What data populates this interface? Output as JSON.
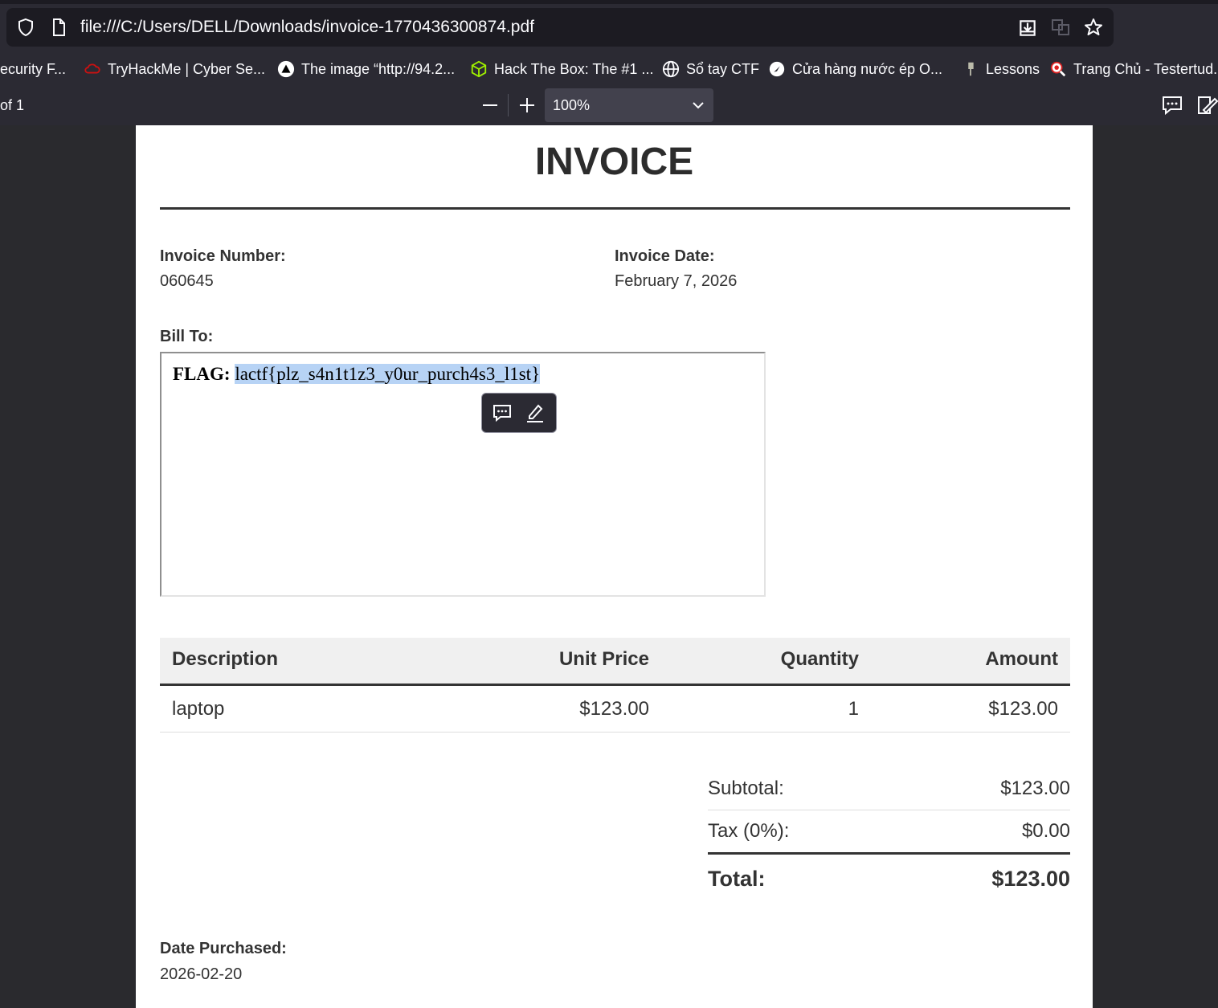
{
  "browser": {
    "url": "file:///C:/Users/DELL/Downloads/invoice-1770436300874.pdf",
    "bookmarks": [
      {
        "label": "ecurity F...",
        "icon": "none"
      },
      {
        "label": "TryHackMe | Cyber Se...",
        "icon": "cloud-icon"
      },
      {
        "label": "The image “http://94.2...",
        "icon": "triangle-icon"
      },
      {
        "label": "Hack The Box: The #1 ...",
        "icon": "cube-icon"
      },
      {
        "label": "Sổ tay CTF",
        "icon": "globe-icon"
      },
      {
        "label": "Cửa hàng nước ép O...",
        "icon": "compass-icon"
      },
      {
        "label": "Lessons",
        "icon": "pin-icon"
      },
      {
        "label": "Trang Chủ - Testertud...",
        "icon": "magnifier-bug-icon"
      }
    ]
  },
  "pdf_toolbar": {
    "page_count": "of 1",
    "zoom": "100%"
  },
  "invoice": {
    "title": "INVOICE",
    "number_label": "Invoice Number:",
    "number": "060645",
    "date_label": "Invoice Date:",
    "date": "February 7, 2026",
    "bill_to_label": "Bill To:",
    "flag_label": "FLAG:",
    "flag_value": "lactf{plz_s4n1t1z3_y0ur_purch4s3_l1st}",
    "table": {
      "headers": [
        "Description",
        "Unit Price",
        "Quantity",
        "Amount"
      ],
      "rows": [
        [
          "laptop",
          "$123.00",
          "1",
          "$123.00"
        ]
      ]
    },
    "subtotal_label": "Subtotal:",
    "subtotal": "$123.00",
    "tax_label": "Tax (0%):",
    "tax": "$0.00",
    "total_label": "Total:",
    "total": "$123.00",
    "purchased_label": "Date Purchased:",
    "purchased": "2026-02-20"
  }
}
